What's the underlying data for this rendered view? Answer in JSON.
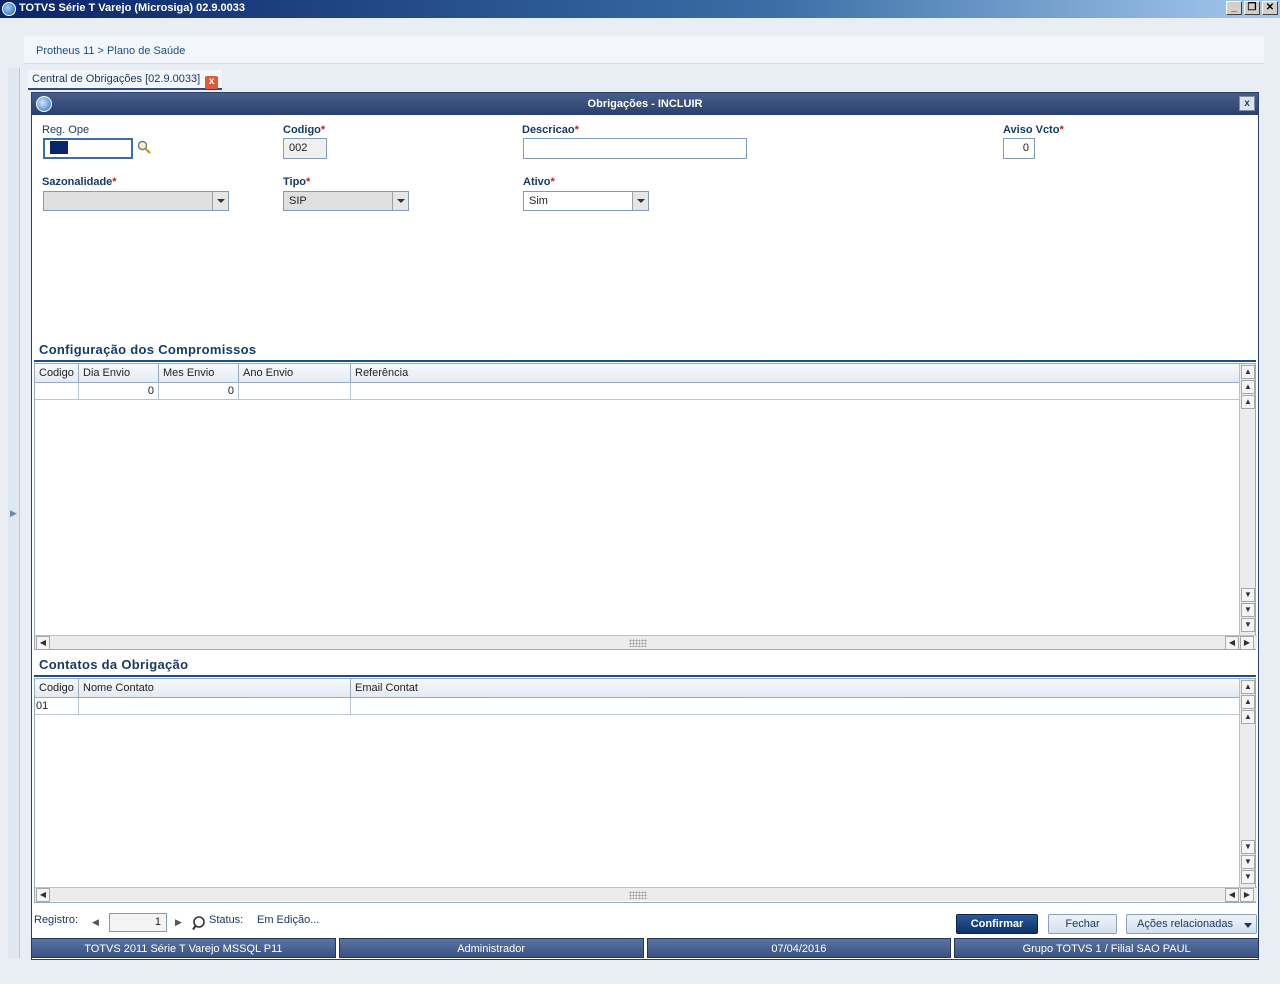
{
  "app": {
    "title": "TOTVS Série T Varejo (Microsiga) 02.9.0033",
    "window_buttons": {
      "minimize": "_",
      "restore": "❐",
      "close": "✕"
    }
  },
  "breadcrumb": "Protheus 11 > Plano de Saúde",
  "tab": {
    "label": "Central de Obrigações [02.9.0033]",
    "close": "x"
  },
  "dialog": {
    "title": "Obrigações - INCLUIR",
    "close": "x",
    "fields": {
      "reg_ope": {
        "label": "Reg. Ope",
        "value": ""
      },
      "codigo": {
        "label": "Codigo",
        "required": "*",
        "value": "002"
      },
      "descricao": {
        "label": "Descricao",
        "required": "*",
        "value": ""
      },
      "aviso_vcto": {
        "label": "Aviso Vcto",
        "required": "*",
        "value": "0"
      },
      "sazonalidade": {
        "label": "Sazonalidade",
        "required": "*",
        "value": ""
      },
      "tipo": {
        "label": "Tipo",
        "required": "*",
        "value": "SIP"
      },
      "ativo": {
        "label": "Ativo",
        "required": "*",
        "value": "Sim"
      }
    },
    "section_compromissos": {
      "title": "Configuração dos Compromissos",
      "columns": [
        "Codigo",
        "Dia Envio",
        "Mes Envio",
        "Ano Envio",
        "Referência"
      ],
      "rows": [
        [
          "",
          "0",
          "0",
          "",
          ""
        ]
      ]
    },
    "section_contatos": {
      "title": "Contatos da Obrigação",
      "columns": [
        "Codigo",
        "Nome Contato",
        "Email Contat"
      ],
      "rows": [
        [
          "01",
          "",
          ""
        ]
      ]
    },
    "footer": {
      "registro_label": "Registro:",
      "registro_value": "1",
      "status_label": "Status:",
      "status_value": "Em Edição...",
      "confirm": "Confirmar",
      "close": "Fechar",
      "actions": "Ações relacionadas"
    }
  },
  "statusbar": [
    "TOTVS 2011 Série T Varejo MSSQL P11",
    "Administrador",
    "07/04/2016",
    "Grupo TOTVS 1 / Filial SAO PAUL"
  ]
}
